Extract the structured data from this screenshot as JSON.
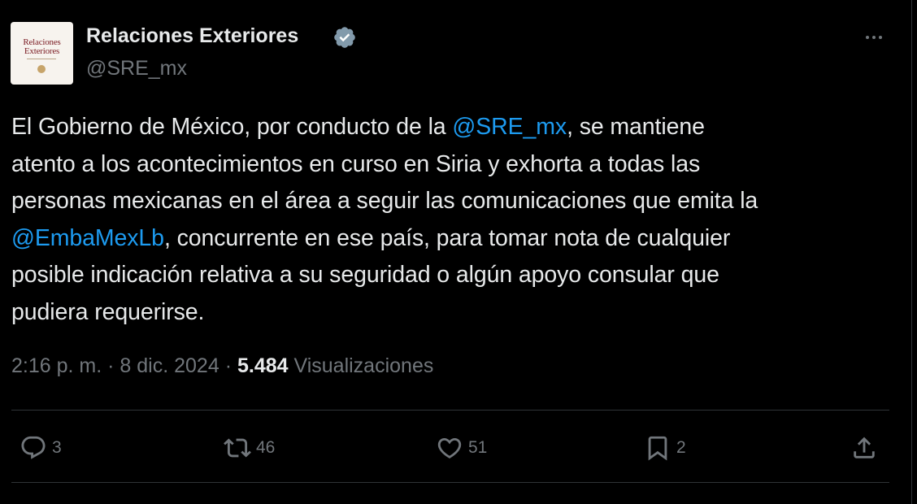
{
  "account": {
    "avatar_text_line1": "Relaciones",
    "avatar_text_line2": "Exteriores",
    "display_name": "Relaciones Exteriores",
    "handle": "@SRE_mx",
    "verified_icon": "verified-badge-icon"
  },
  "tweet": {
    "lines": [
      [
        {
          "text": "El Gobierno de México, por conducto de la ",
          "type": "text"
        },
        {
          "text": "@SRE_mx",
          "type": "mention"
        },
        {
          "text": ", se mantiene",
          "type": "text"
        }
      ],
      [
        {
          "text": "atento a los acontecimientos en curso en Siria y exhorta a todas las",
          "type": "text"
        }
      ],
      [
        {
          "text": "personas mexicanas en el área a seguir las comunicaciones que emita la",
          "type": "text"
        }
      ],
      [
        {
          "text": "@EmbaMexLb",
          "type": "mention"
        },
        {
          "text": ", concurrente en ese país, para tomar nota de cualquier",
          "type": "text"
        }
      ],
      [
        {
          "text": "posible indicación relativa a su seguridad o algún apoyo consular que",
          "type": "text"
        }
      ],
      [
        {
          "text": "pudiera requerirse.",
          "type": "text"
        }
      ]
    ],
    "time": "2:16 p. m.",
    "separator": "·",
    "date": "8 dic. 2024",
    "views_count": "5.484",
    "views_label": "Visualizaciones"
  },
  "actions": {
    "reply": {
      "icon": "reply-icon",
      "count": "3"
    },
    "retweet": {
      "icon": "retweet-icon",
      "count": "46"
    },
    "like": {
      "icon": "heart-icon",
      "count": "51"
    },
    "bookmark": {
      "icon": "bookmark-icon",
      "count": "2"
    },
    "share": {
      "icon": "share-icon"
    }
  },
  "colors": {
    "background": "#000000",
    "text": "#e7e9ea",
    "muted": "#71767b",
    "link": "#1d9bf0",
    "divider": "#2f3336",
    "verified": "#829aab"
  }
}
